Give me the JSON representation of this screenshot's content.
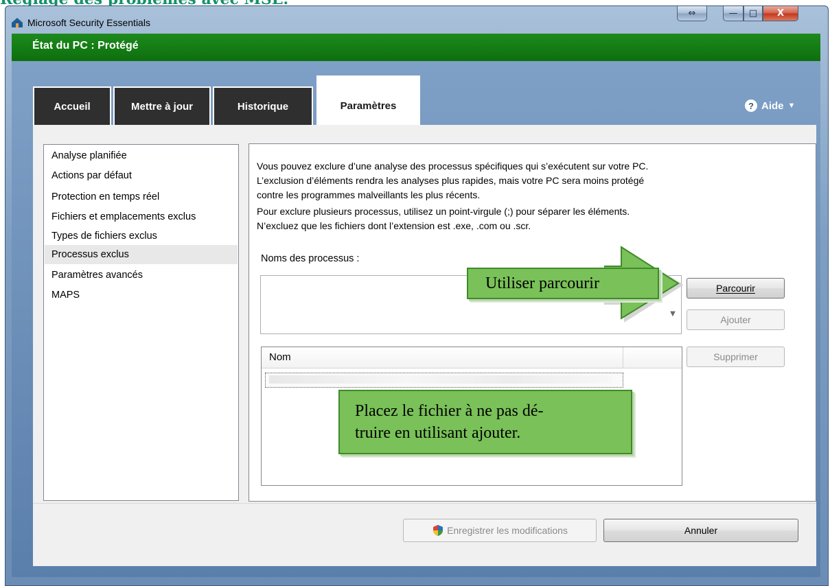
{
  "doc": {
    "heading": "Réglage des problèmes avec MSE."
  },
  "window": {
    "title": "Microsoft Security Essentials",
    "buttons": {
      "resize": "⇔",
      "minimize": "—",
      "maximize": "□",
      "close": "X"
    }
  },
  "status": {
    "text": "État du PC : Protégé",
    "color": "#0f7a0f"
  },
  "tabs": [
    {
      "label": "Accueil"
    },
    {
      "label": "Mettre à jour"
    },
    {
      "label": "Historique"
    },
    {
      "label": "Paramètres",
      "selected": true
    }
  ],
  "help": {
    "icon": "help-icon",
    "label": "Aide",
    "caret": "▼"
  },
  "sidebar": {
    "items": [
      {
        "label": "Analyse planifiée"
      },
      {
        "label": "Actions par défaut"
      },
      {
        "label": "Protection en temps réel"
      },
      {
        "label": "Fichiers et emplacements exclus"
      },
      {
        "label": "Types de fichiers exclus"
      },
      {
        "label": "Processus exclus",
        "selected": true
      },
      {
        "label": "Paramètres avancés"
      },
      {
        "label": "MAPS"
      }
    ]
  },
  "main": {
    "description": [
      "Vous pouvez exclure d’une analyse des processus spécifiques qui s’exécutent sur votre PC.",
      "L’exclusion d’éléments rendra les analyses plus rapides, mais votre PC sera moins protégé",
      "contre les programmes malveillants les plus récents.",
      "Pour exclure plusieurs processus, utilisez un point-virgule (;) pour séparer les éléments.",
      "N’excluez que les fichiers dont l’extension est .exe, .com ou .scr."
    ],
    "process_label": "Noms des processus :",
    "process_input": {
      "value": "",
      "placeholder": ""
    },
    "browse_button": "Parcourir",
    "add_button": "Ajouter",
    "remove_button": "Supprimer",
    "table": {
      "columns": [
        "Nom"
      ]
    }
  },
  "footer": {
    "save_button": "Enregistrer les modifications",
    "cancel_button": "Annuler"
  },
  "callouts": {
    "browse": "Utiliser parcourir",
    "place_line1": "Placez le fichier à ne pas dé-",
    "place_line2": "truire en utilisant ajouter."
  },
  "colors": {
    "accent_green": "#79c158",
    "status_green": "#0f7a0f",
    "heading_green": "#14906a"
  }
}
